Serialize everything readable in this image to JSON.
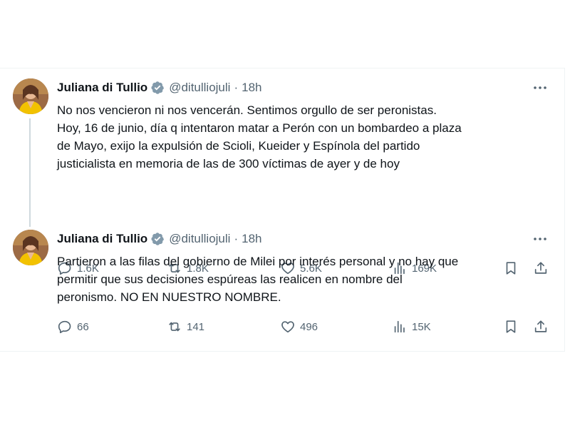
{
  "tweets": [
    {
      "author_name": "Juliana di Tullio",
      "handle": "@ditulliojuli",
      "separator": "·",
      "time": "18h",
      "text_lines": [
        "No nos vencieron ni nos vencerán. Sentimos orgullo de ser peronistas.",
        "Hoy, 16 de junio, día q intentaron matar a Perón con un bombardeo a plaza",
        "de Mayo, exijo la expulsión de Scioli, Kueider y Espínola del partido",
        "justicialista en memoria de las de 300 víctimas de ayer y de hoy"
      ],
      "replies": "1.6K",
      "reposts": "1.8K",
      "likes": "5.6K",
      "views": "169K"
    },
    {
      "author_name": "Juliana di Tullio",
      "handle": "@ditulliojuli",
      "separator": "·",
      "time": "18h",
      "text_lines": [
        "Partieron a las filas del gobierno de Milei por interés personal y no hay que",
        "permitir que sus decisiones espúreas las realicen en nombre del",
        "peronismo. NO EN NUESTRO NOMBRE."
      ],
      "replies": "66",
      "reposts": "141",
      "likes": "496",
      "views": "15K"
    }
  ],
  "icons": {
    "verified": "verified-badge-icon",
    "more": "more-icon",
    "reply": "reply-icon",
    "repost": "repost-icon",
    "like": "heart-icon",
    "views": "views-icon",
    "bookmark": "bookmark-icon",
    "share": "share-icon"
  },
  "colors": {
    "text": "#0f1419",
    "secondary": "#536471",
    "verified": "#829aab",
    "border": "#eff3f4"
  }
}
